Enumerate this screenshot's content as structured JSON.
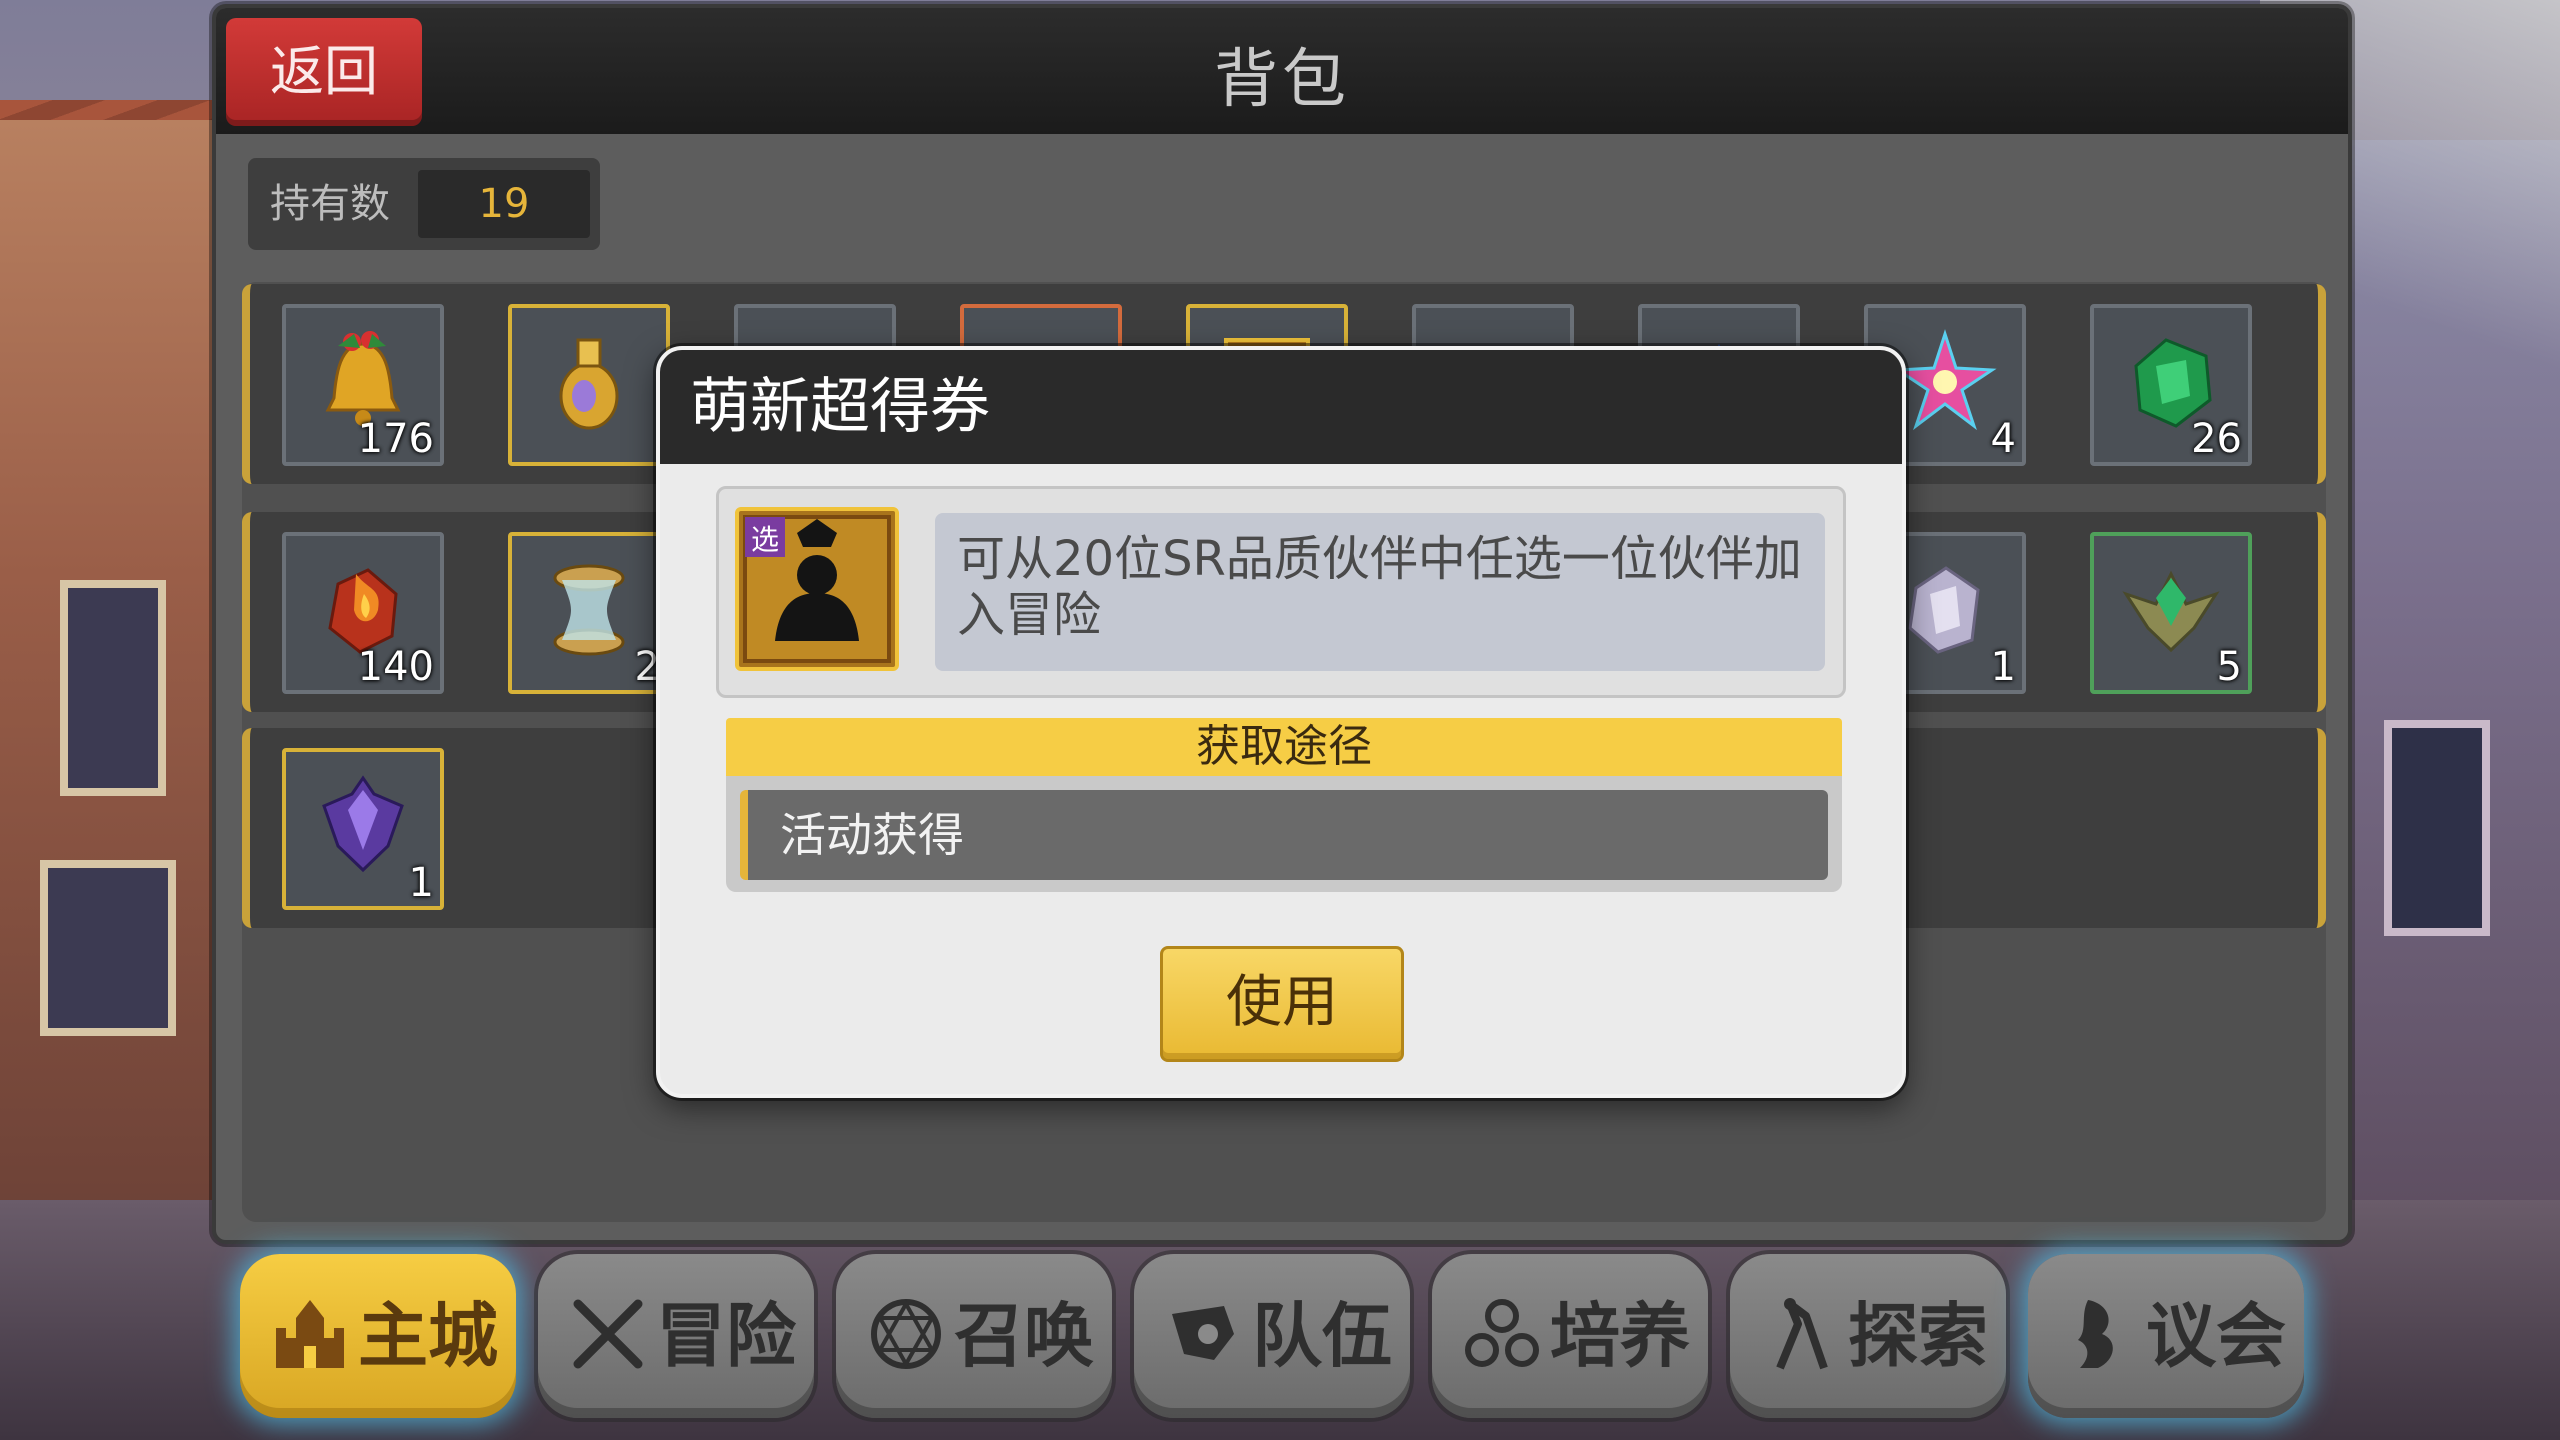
{
  "panel": {
    "back_label": "返回",
    "title": "背包",
    "hold_label": "持有数",
    "hold_value": "19"
  },
  "inventory": {
    "row1": [
      {
        "icon": "bell-icon",
        "count": "176"
      },
      {
        "icon": "potion-vase-icon",
        "count": ""
      },
      {
        "icon": "item-icon",
        "count": ""
      },
      {
        "icon": "item-icon",
        "count": ""
      },
      {
        "icon": "ticket-icon",
        "count": ""
      },
      {
        "icon": "item-icon",
        "count": ""
      },
      {
        "icon": "item-icon",
        "count": ""
      },
      {
        "icon": "star-crystal-icon",
        "count": "4"
      },
      {
        "icon": "green-ore-icon",
        "count": "26"
      }
    ],
    "row2": [
      {
        "icon": "fire-stone-icon",
        "count": "140"
      },
      {
        "icon": "hourglass-icon",
        "count": "2"
      },
      {
        "icon": "silver-ore-icon",
        "count": "1"
      },
      {
        "icon": "green-emblem-icon",
        "count": "5"
      }
    ],
    "row3": [
      {
        "icon": "purple-crystal-icon",
        "count": "1"
      }
    ]
  },
  "dialog": {
    "title": "萌新超得券",
    "item_icon": "select-ticket-icon",
    "item_badge": "选",
    "description": "可从20位SR品质伙伴中任选一位伙伴加入冒险",
    "route_header": "获取途径",
    "route_item": "活动获得",
    "use_label": "使用"
  },
  "nav": [
    {
      "label": "主城",
      "icon": "castle-icon"
    },
    {
      "label": "冒险",
      "icon": "crossed-swords-icon"
    },
    {
      "label": "召唤",
      "icon": "summon-circle-icon"
    },
    {
      "label": "队伍",
      "icon": "team-icon"
    },
    {
      "label": "培养",
      "icon": "train-icon"
    },
    {
      "label": "探索",
      "icon": "explore-icon"
    },
    {
      "label": "议会",
      "icon": "council-icon"
    }
  ],
  "colors": {
    "accent_gold": "#f6cd45",
    "back_red": "#c62f2e",
    "count_yellow": "#e6b53a"
  }
}
